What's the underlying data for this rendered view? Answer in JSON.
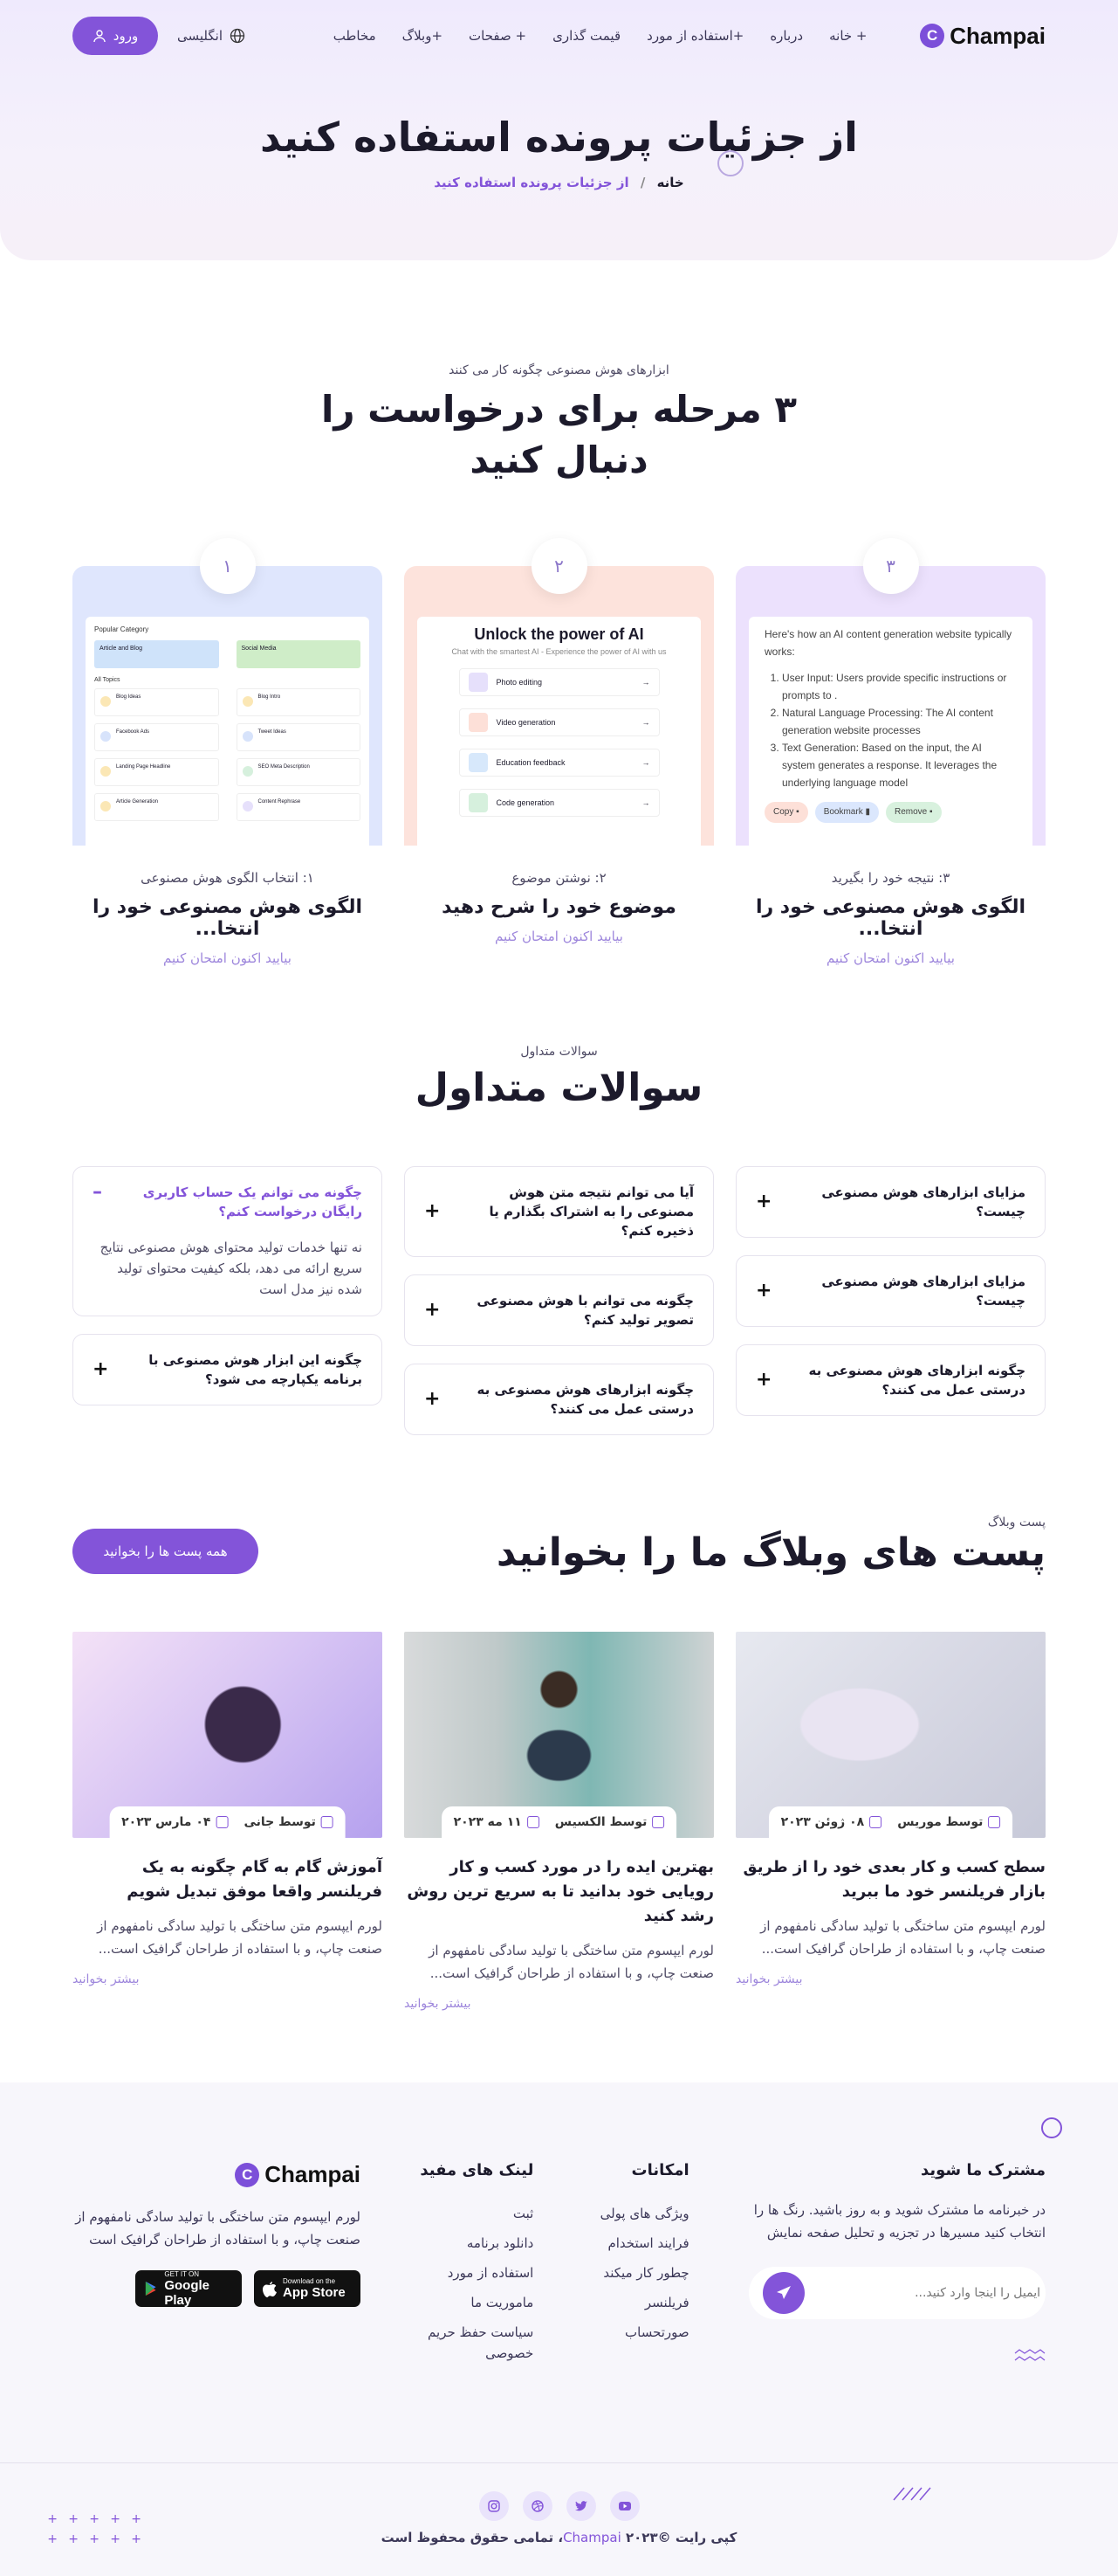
{
  "nav": {
    "brand": "Champai",
    "brand_initial": "C",
    "menu": [
      "+ خانه",
      "درباره",
      "+استفاده از مورد",
      "قیمت گذاری",
      "+ صفحات",
      "+وبلاگ",
      "مخاطب"
    ],
    "language": "انگلیسی",
    "login": "ورود"
  },
  "hero": {
    "title": "از جزئیات پرونده استفاده کنید",
    "breadcrumb_home": "خانه",
    "breadcrumb_sep": "/",
    "breadcrumb_current": "از جزئیات پرونده استفاده کنید"
  },
  "steps": {
    "label": "ابزارهای هوش مصنوعی چگونه کار می کنند",
    "title": "۳ مرحله برای درخواست را دنبال کنید",
    "items": [
      {
        "num": "۱",
        "step": "۱: انتخاب الگوی هوش مصنوعی",
        "heading": "الگوی هوش مصنوعی خود را انتخا...",
        "link": "بیایید اکنون امتحان کنیم",
        "color": "#dfe6fd"
      },
      {
        "num": "۲",
        "step": "۲: نوشتن موضوع",
        "heading": "موضوع خود را شرح دهید",
        "link": "بیایید اکنون امتحان کنیم",
        "color": "#fde3dc"
      },
      {
        "num": "۳",
        "step": "۳: نتیجه خود را بگیرید",
        "heading": "الگوی هوش مصنوعی خود را انتخا...",
        "link": "بیایید اکنون امتحان کنیم",
        "color": "#ece1fd"
      }
    ],
    "shot1": {
      "popular": "Popular Category",
      "cards": [
        "Article and Blog",
        "Social Media"
      ],
      "all": "All Topics",
      "topics": [
        "Blog Ideas",
        "Blog Intro",
        "Facebook Ads",
        "Tweet Ideas",
        "Landing Page Headline",
        "SEO Meta Description",
        "Article Generation",
        "Content Rephrase"
      ]
    },
    "shot2": {
      "title": "Unlock the power of AI",
      "sub": "Chat with the smartest AI - Experience the power of AI with us",
      "rows": [
        "Photo editing",
        "Video generation",
        "Education feedback",
        "Code generation"
      ]
    },
    "shot3": {
      "intro": "Here's how an AI content generation website typically works:",
      "list": [
        "User Input: Users provide specific instructions or prompts to .",
        "Natural Language Processing: The AI content generation website processes",
        "Text Generation: Based on the input, the AI system generates a response. It leverages the underlying language model"
      ],
      "buttons": [
        "Copy",
        "Bookmark",
        "Remove"
      ]
    }
  },
  "faq": {
    "label": "سوالات متداول",
    "title": "سوالات متداول",
    "col1": [
      {
        "q": "چگونه می توانم یک حساب کاربری رایگان درخواست کنم؟",
        "a": "نه تنها خدمات تولید محتوای هوش مصنوعی نتایج سریع ارائه می دهد، بلکه کیفیت محتوای تولید شده نیز مدل است",
        "open": true,
        "icon": "–"
      },
      {
        "q": "چگونه این ابزار هوش مصنوعی با برنامه یکپارچه می شود؟",
        "icon": "+"
      }
    ],
    "col2": [
      {
        "q": "آیا می توانم نتیجه متن هوش مصنوعی را به اشتراک بگذارم یا ذخیره کنم؟",
        "icon": "+"
      },
      {
        "q": "چگونه می توانم با هوش مصنوعی تصویر تولید کنم؟",
        "icon": "+"
      },
      {
        "q": "چگونه ابزارهای هوش مصنوعی به درستی عمل می کنند؟",
        "icon": "+"
      }
    ],
    "col3": [
      {
        "q": "مزایای ابزارهای هوش مصنوعی چیست؟",
        "icon": "+"
      },
      {
        "q": "مزایای ابزارهای هوش مصنوعی چیست؟",
        "icon": "+"
      },
      {
        "q": "چگونه ابزارهای هوش مصنوعی به درستی عمل می کنند؟",
        "icon": "+"
      }
    ]
  },
  "blog": {
    "label": "پست وبلاگ",
    "title": "پست های وبلاگ ما را بخوانید",
    "all_button": "همه پست ها را بخوانید",
    "posts": [
      {
        "author": "توسط جانی",
        "date": "۰۴ مارس ۲۰۲۳",
        "title": "آموزش گام به گام چگونه به یک فریلنسر واقعا موفق تبدیل شویم",
        "excerpt": "لورم ایپسوم متن ساختگی با تولید سادگی نامفهوم از صنعت چاپ، و با استفاده از طراحان گرافیک است...",
        "more": "بیشتر بخوانید"
      },
      {
        "author": "توسط الکسیس",
        "date": "۱۱ مه ۲۰۲۳",
        "title": "بهترین ایده را در مورد کسب و کار رویایی خود بدانید تا به سریع ترین روش رشد کنید",
        "excerpt": "لورم ایپسوم متن ساختگی با تولید سادگی نامفهوم از صنعت چاپ، و با استفاده از طراحان گرافیک است...",
        "more": "بیشتر بخوانید"
      },
      {
        "author": "توسط موریس",
        "date": "۰۸ ژوئن ۲۰۲۳",
        "title": "سطح کسب و کار بعدی خود را از طریق بازار فریلنسر خود ما ببرید",
        "excerpt": "لورم ایپسوم متن ساختگی با تولید سادگی نامفهوم از صنعت چاپ، و با استفاده از طراحان گرافیک است...",
        "more": "بیشتر بخوانید"
      }
    ]
  },
  "footer": {
    "brand": "Champai",
    "brand_initial": "C",
    "about": "لورم ایپسوم متن ساختگی با تولید سادگی نامفهوم از صنعت چاپ، و با استفاده از طراحان گرافیک است",
    "google_small": "GET IT ON",
    "google_big": "Google Play",
    "apple_small": "Download on the",
    "apple_big": "App Store",
    "links_title": "لینک های مفید",
    "links": [
      "ثبت",
      "دانلود برنامه",
      "استفاده از مورد",
      "ماموریت ما",
      "سیاست حفظ حریم خصوصی"
    ],
    "features_title": "امکانات",
    "features": [
      "ویژگی های پولی",
      "فرایند استخدام",
      "چطور کار میکند",
      "فریلنسر",
      "صورتحساب"
    ],
    "subscribe_title": "مشترک ما شوید",
    "subscribe_text": "در خبرنامه ما مشترک شوید و به روز باشید. رنگ ها را انتخاب کنید مسیرها در تجزیه و تحلیل صفحه نمایش",
    "email_placeholder": "ایمیل را اینجا وارد کنید...",
    "copyright_pre": "کپی رایت ©۲۰۲۳",
    "copyright_brand": "Champai",
    "copyright_post": "، تمامی حقوق محفوظ است"
  }
}
